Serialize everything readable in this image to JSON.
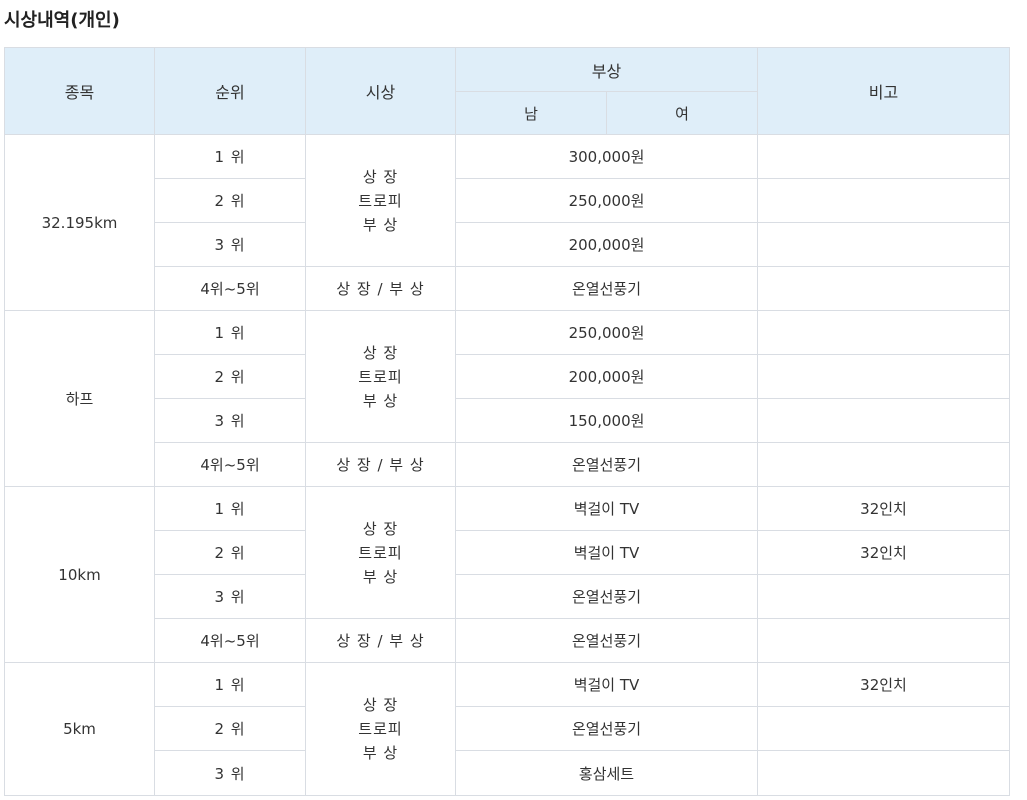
{
  "title": "시상내역(개인)",
  "headers": {
    "event": "종목",
    "rank": "순위",
    "award": "시상",
    "prize": "부상",
    "male": "남",
    "female": "여",
    "note": "비고"
  },
  "events": [
    {
      "name": "32.195km",
      "top_award": [
        "상 장",
        "트로피",
        "부 상"
      ],
      "rows": [
        {
          "rank": "1 위",
          "prize": "300,000원",
          "note": ""
        },
        {
          "rank": "2 위",
          "prize": "250,000원",
          "note": ""
        },
        {
          "rank": "3 위",
          "prize": "200,000원",
          "note": ""
        },
        {
          "rank": "4위~5위",
          "award": "상 장 / 부 상",
          "prize": "온열선풍기",
          "note": ""
        }
      ]
    },
    {
      "name": "하프",
      "top_award": [
        "상 장",
        "트로피",
        "부 상"
      ],
      "rows": [
        {
          "rank": "1 위",
          "prize": "250,000원",
          "note": ""
        },
        {
          "rank": "2 위",
          "prize": "200,000원",
          "note": ""
        },
        {
          "rank": "3 위",
          "prize": "150,000원",
          "note": ""
        },
        {
          "rank": "4위~5위",
          "award": "상 장 / 부 상",
          "prize": "온열선풍기",
          "note": ""
        }
      ]
    },
    {
      "name": "10km",
      "top_award": [
        "상 장",
        "트로피",
        "부 상"
      ],
      "rows": [
        {
          "rank": "1 위",
          "prize": "벽걸이 TV",
          "note": "32인치"
        },
        {
          "rank": "2 위",
          "prize": "벽걸이 TV",
          "note": "32인치"
        },
        {
          "rank": "3 위",
          "prize": "온열선풍기",
          "note": ""
        },
        {
          "rank": "4위~5위",
          "award": "상 장 / 부 상",
          "prize": "온열선풍기",
          "note": ""
        }
      ]
    },
    {
      "name": "5km",
      "top_award": [
        "상 장",
        "트로피",
        "부 상"
      ],
      "rows": [
        {
          "rank": "1 위",
          "prize": "벽걸이 TV",
          "note": "32인치"
        },
        {
          "rank": "2 위",
          "prize": "온열선풍기",
          "note": ""
        },
        {
          "rank": "3 위",
          "prize": "홍삼세트",
          "note": ""
        }
      ]
    }
  ]
}
